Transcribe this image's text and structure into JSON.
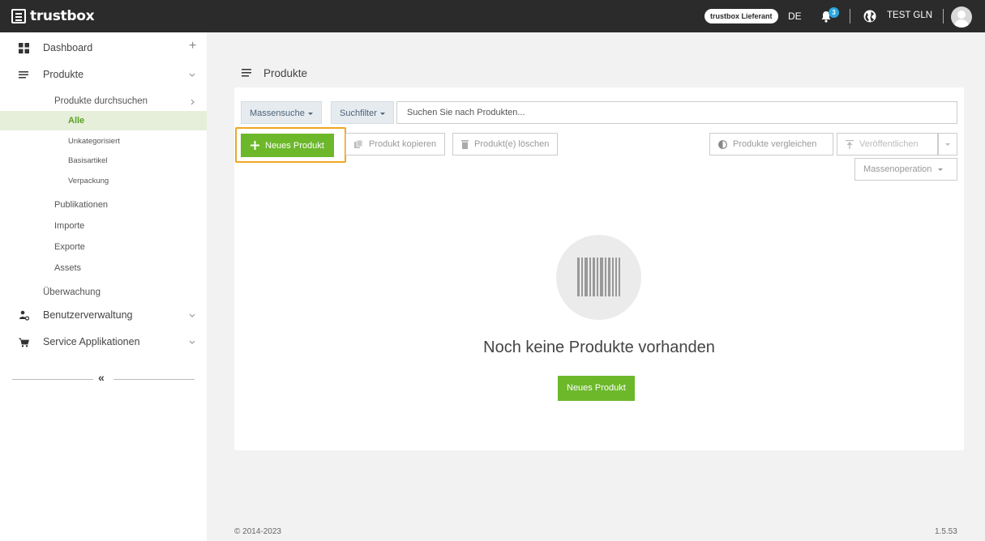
{
  "topbar": {
    "brand": "trustbox",
    "role_badge": "trustbox Lieferant",
    "language": "DE",
    "notifications_count": "3",
    "account_name": "TEST GLN"
  },
  "sidebar": {
    "dashboard": "Dashboard",
    "dashboard_action": "+",
    "products": "Produkte",
    "products_browse": "Produkte durchsuchen",
    "filters": {
      "all": "Alle",
      "uncategorized": "Unkategorisiert",
      "base_article": "Basisartikel",
      "packaging": "Verpackung"
    },
    "publications": "Publikationen",
    "imports": "Importe",
    "exports": "Exporte",
    "assets": "Assets",
    "monitoring": "Überwachung",
    "user_management": "Benutzerverwaltung",
    "service_apps": "Service Applikationen",
    "collapse": "«"
  },
  "main": {
    "page_title": "Produkte",
    "mass_search": "Massensuche",
    "search_filter": "Suchfilter",
    "search_placeholder": "Suchen Sie nach Produkten...",
    "new_product": "Neues Produkt",
    "copy_product": "Produkt kopieren",
    "delete_products": "Produkt(e) löschen",
    "compare_products": "Produkte vergleichen",
    "publish": "Veröffentlichen",
    "mass_operation": "Massenoperation",
    "empty_text": "Noch keine Produkte vorhanden",
    "empty_new_product": "Neues Produkt"
  },
  "footer": {
    "copyright": "© 2014-2023",
    "version": "1.5.53"
  },
  "colors": {
    "topbar": "#2b2b2b",
    "primary_green": "#6cb82a",
    "highlight_orange": "#f0a623",
    "badge_blue": "#2aa6de"
  }
}
